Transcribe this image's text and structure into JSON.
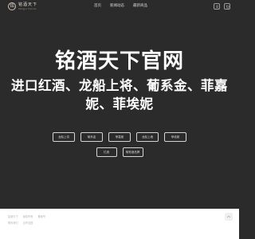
{
  "brand": {
    "mark": "铭",
    "name_cn": "铭酒天下",
    "name_en": "Mingjiu Tianxia"
  },
  "nav": {
    "items": [
      {
        "label": "首页"
      },
      {
        "label": "新闻动态"
      },
      {
        "label": "最新商品"
      }
    ]
  },
  "header_icons": [
    "user-icon",
    "cart-icon"
  ],
  "hero": {
    "title": "铭酒天下官网",
    "subtitle": "进口红酒、龙船上将、葡系金、菲嘉妮、菲埃妮"
  },
  "tags": [
    {
      "label": "龙船上将"
    },
    {
      "label": "葡系金"
    },
    {
      "label": "菲嘉妮"
    },
    {
      "label": "龙船上墙"
    },
    {
      "label": "菲埃妮"
    },
    {
      "label": "红酒"
    },
    {
      "label": "葡萄酒品牌"
    }
  ],
  "footer": {
    "line1": [
      "铭酒天下",
      "版权所有",
      "备案号"
    ],
    "line2": [
      "联系我们",
      "合作加盟"
    ]
  },
  "colors": {
    "background": "#2b2b2b",
    "text_primary": "#ffffff",
    "footer_bg": "#ffffff"
  }
}
